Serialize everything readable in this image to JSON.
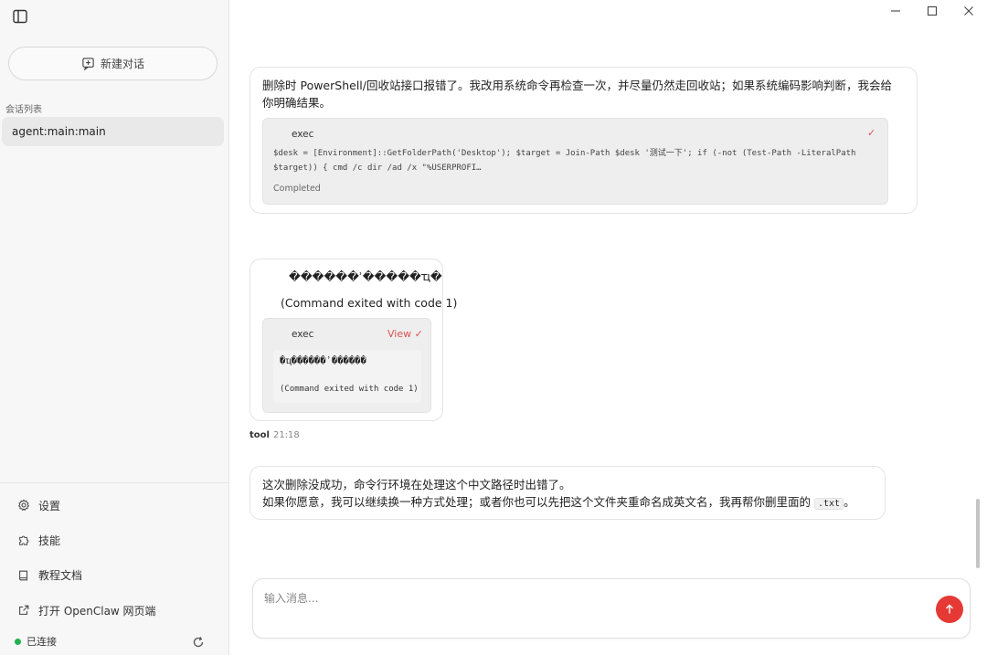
{
  "sidebar": {
    "new_chat_label": "新建对话",
    "sessions_heading": "会话列表",
    "sessions": [
      {
        "label": "agent:main:main"
      }
    ],
    "menu": [
      {
        "label": "设置",
        "icon": "gear-icon"
      },
      {
        "label": "技能",
        "icon": "puzzle-icon"
      },
      {
        "label": "教程文档",
        "icon": "book-icon"
      },
      {
        "label": "打开 OpenClaw 网页端",
        "icon": "external-link-icon"
      }
    ],
    "status_label": "已连接",
    "status_color": "#22b14c"
  },
  "messages": {
    "m1": {
      "text": "删除时 PowerShell/回收站接口报错了。我改用系统命令再检查一次，并尽量仍然走回收站；如果系统编码影响判断，我会给你明确结果。",
      "tool": {
        "name": "exec",
        "check": "✓",
        "code_line1": "$desk = [Environment]::GetFolderPath('Desktop'); $target = Join-Path $desk '测试一下'; if (-not (Test-Path -LiteralPath",
        "code_line2": "$target)) { cmd /c dir /ad /x \"%USERPROFI…",
        "status": "Completed"
      }
    },
    "m2": {
      "line1": "������ʾ�����ҵ�",
      "line2": "(Command exited with code 1)",
      "tool": {
        "name": "exec",
        "view_label": "View ✓",
        "out_line1": "�ҵ������ʾ������",
        "out_line2": "(Command exited with code 1)"
      },
      "sender": "tool",
      "time": "21:18"
    },
    "m3": {
      "line1": "这次删除没成功，命令行环境在处理这个中文路径时出错了。",
      "line2_pre": "如果你愿意，我可以继续换一种方式处理；或者你也可以先把这个文件夹重命名成英文名，我再帮你删里面的",
      "line2_code": ".txt",
      "line2_post": "。"
    }
  },
  "composer": {
    "placeholder": "输入消息...",
    "value": ""
  },
  "colors": {
    "accent": "#e53935",
    "connected": "#22b14c"
  }
}
